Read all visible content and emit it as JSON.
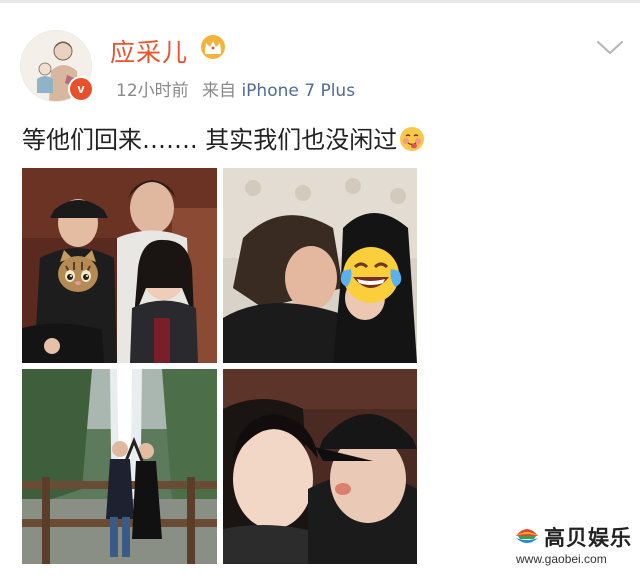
{
  "post": {
    "author": "应采儿",
    "time": "12小时前",
    "source_prefix": "来自",
    "device": "iPhone 7 Plus",
    "text": "等他们回来……. 其实我们也没闲过",
    "verified_badge": "v"
  },
  "icons": {
    "member": "crown-icon",
    "menu": "chevron-down-icon",
    "inline_emoji": "tongue-blush-emoji",
    "face_cover_cat": "cat-face-emoji",
    "face_cover_laugh": "tears-of-joy-emoji"
  },
  "colors": {
    "username": "#e8542e",
    "device_link": "#506c95",
    "meta_text": "#8a8a8a",
    "post_text": "#222222"
  },
  "watermark": {
    "title": "高贝娱乐",
    "url": "www.gaobei.com"
  }
}
